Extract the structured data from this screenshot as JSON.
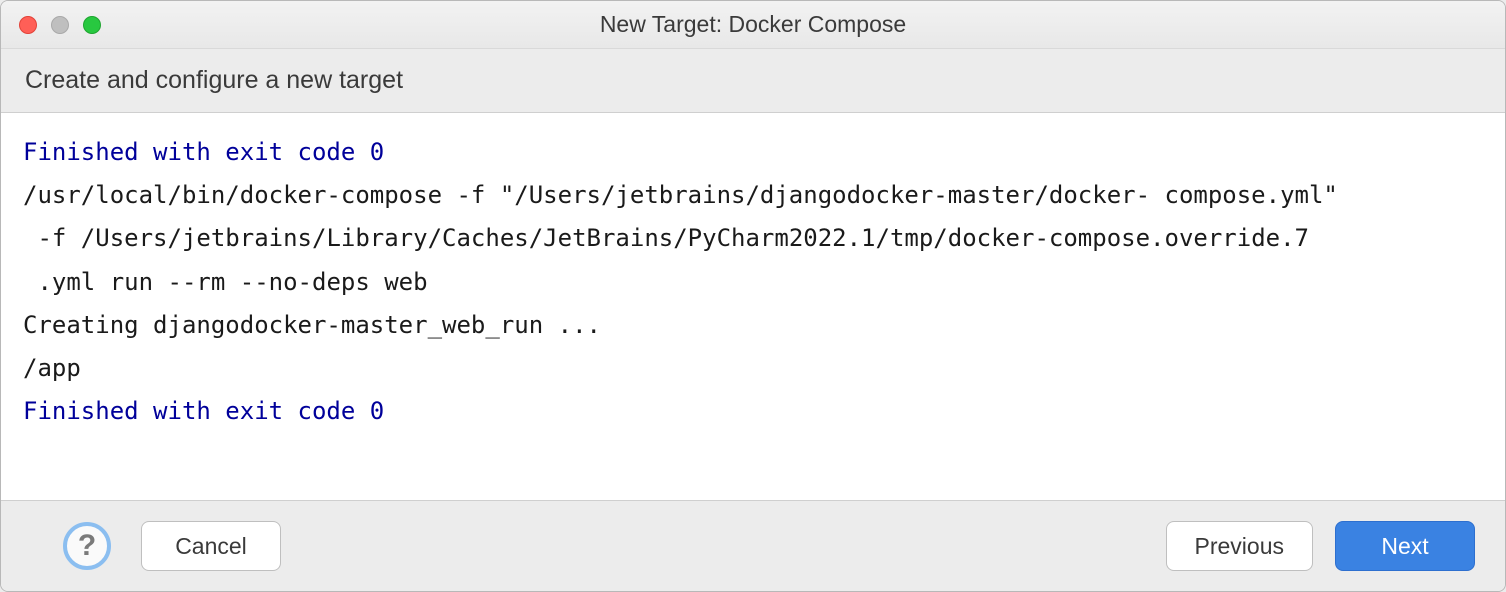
{
  "window": {
    "title": "New Target: Docker Compose",
    "subtitle": "Create and configure a new target"
  },
  "console": {
    "line1": "Finished with exit code 0",
    "line2": "/usr/local/bin/docker-compose -f \"/Users/jetbrains/djangodocker-master/docker- compose.yml\"",
    "line3": " -f /Users/jetbrains/Library/Caches/JetBrains/PyCharm2022.1/tmp/docker-compose.override.7",
    "line4": " .yml run --rm --no-deps web",
    "line5": "Creating djangodocker-master_web_run ...",
    "line6": "/app",
    "line7": "Finished with exit code 0"
  },
  "footer": {
    "help_symbol": "?",
    "cancel_label": "Cancel",
    "previous_label": "Previous",
    "next_label": "Next"
  }
}
